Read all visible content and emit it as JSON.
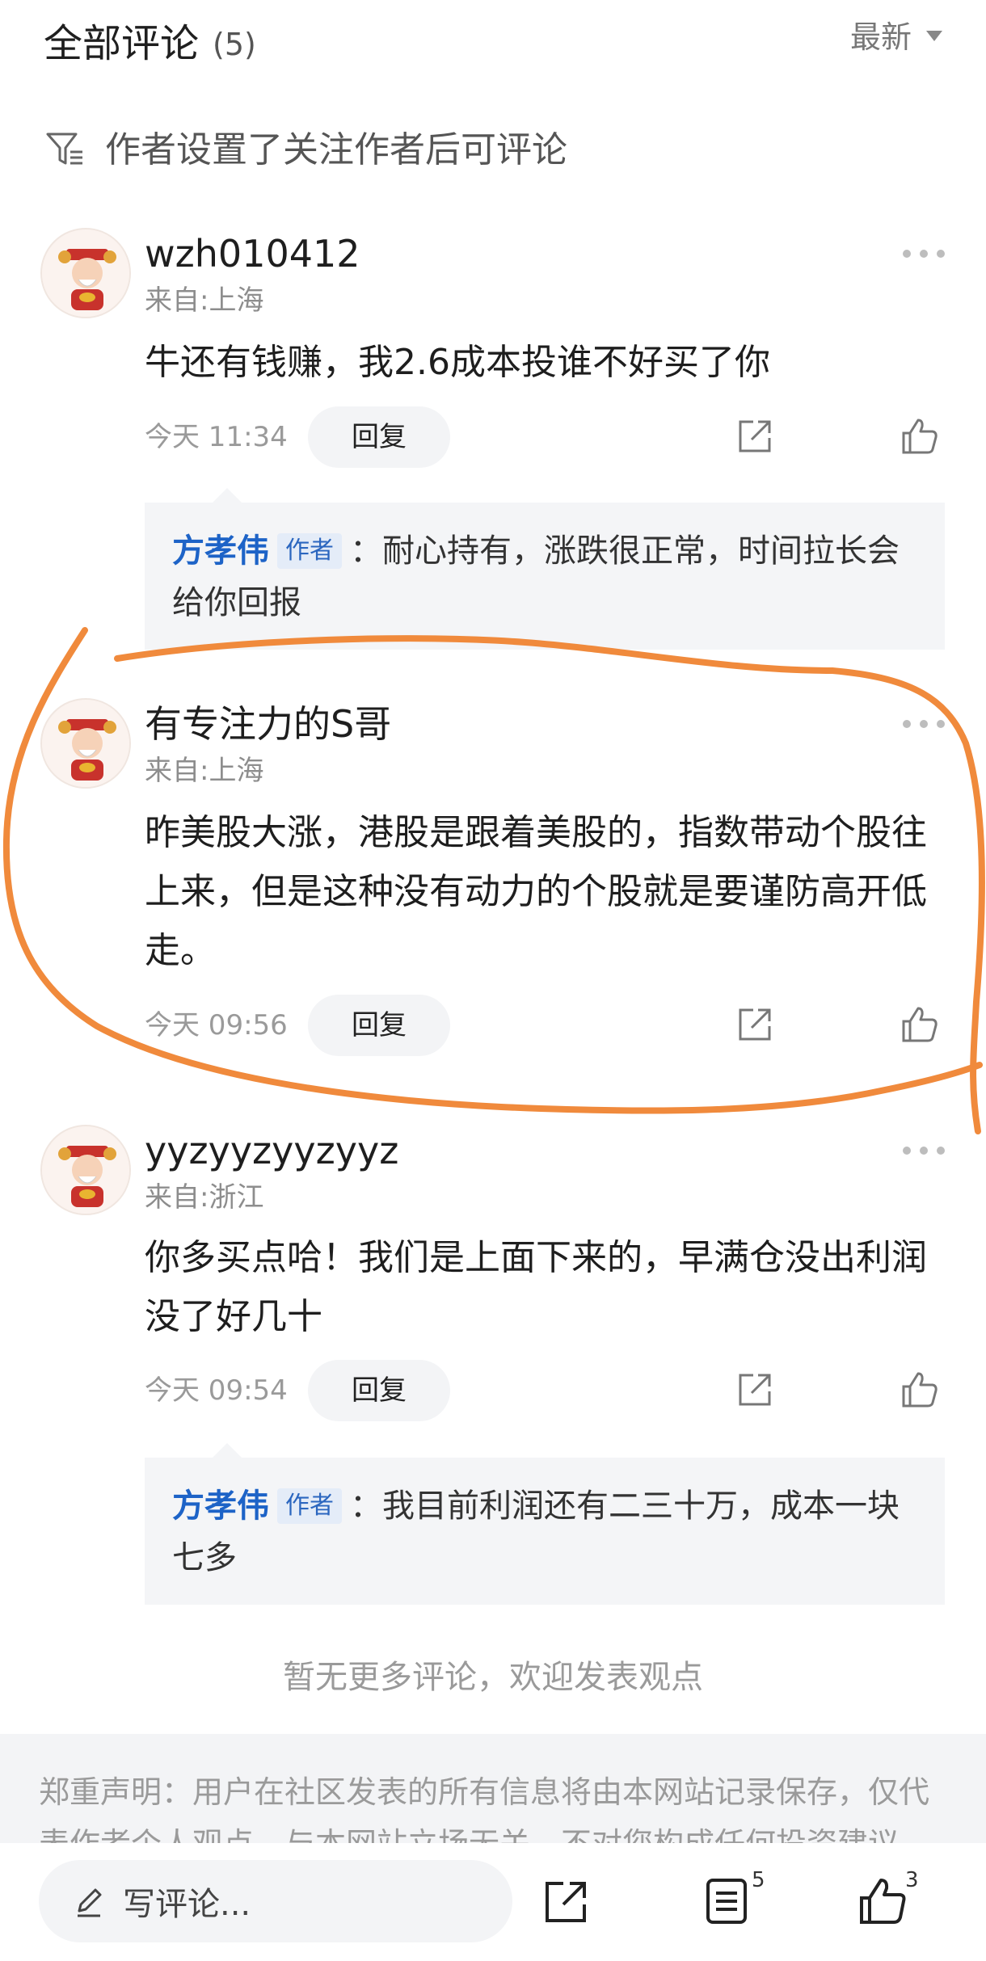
{
  "header": {
    "title": "全部评论",
    "count": "(5)",
    "sort_label": "最新"
  },
  "notice": {
    "icon": "filter-icon",
    "text": "作者设置了关注作者后可评论"
  },
  "comments": [
    {
      "username": "wzh010412",
      "location": "来自:上海",
      "body": "牛还有钱赚，我2.6成本投谁不好买了你",
      "time": "今天 11:34",
      "reply_label": "回复",
      "author_reply": {
        "name": "方孝伟",
        "tag": "作者",
        "text": "：耐心持有，涨跌很正常，时间拉长会给你回报"
      }
    },
    {
      "username": "有专注力的S哥",
      "location": "来自:上海",
      "body": "昨美股大涨，港股是跟着美股的，指数带动个股往上来，但是这种没有动力的个股就是要谨防高开低走。",
      "time": "今天 09:56",
      "reply_label": "回复"
    },
    {
      "username": "yyzyyzyyzyyz",
      "location": "来自:浙江",
      "body": "你多买点哈！我们是上面下来的，早满仓没出利润没了好几十",
      "time": "今天 09:54",
      "reply_label": "回复",
      "author_reply": {
        "name": "方孝伟",
        "tag": "作者",
        "text": "：我目前利润还有二三十万，成本一块七多"
      }
    }
  ],
  "end_text": "暂无更多评论，欢迎发表观点",
  "disclaimer": "郑重声明：用户在社区发表的所有信息将由本网站记录保存，仅代表作者个人观点，与本网站立场无关，不对您构成任何投资建议",
  "bottom_bar": {
    "compose_placeholder": "写评论...",
    "comments_badge": "5",
    "likes_badge": "3"
  },
  "colors": {
    "accent": "#1d63c7",
    "annotation": "#f08a3c",
    "muted": "#9a9a9a"
  }
}
